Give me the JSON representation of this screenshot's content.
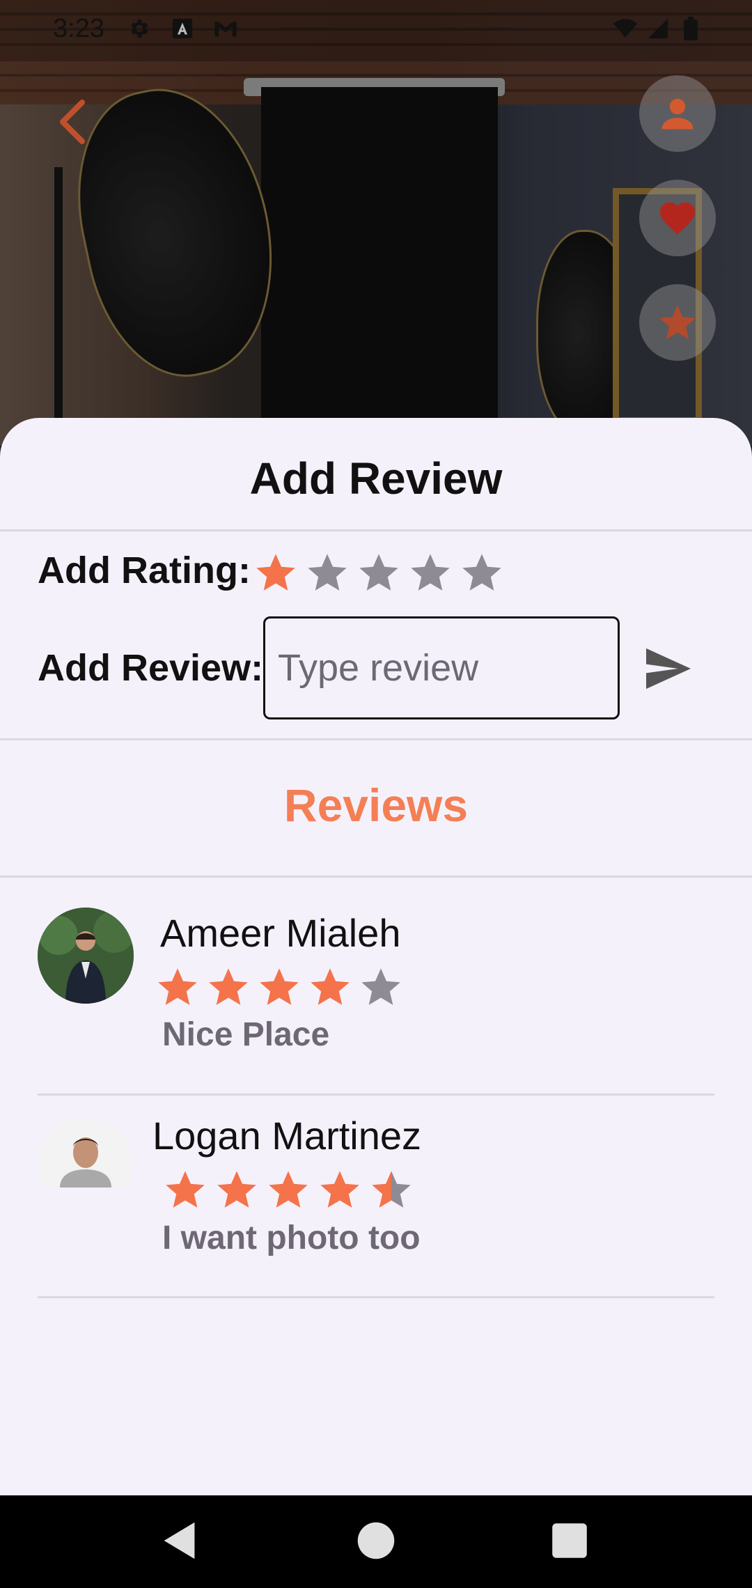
{
  "status_bar": {
    "time": "3:23",
    "left_icons": [
      "settings-icon",
      "a-icon",
      "gmail-icon"
    ],
    "right_icons": [
      "wifi-icon",
      "signal-icon",
      "battery-icon"
    ]
  },
  "hero": {
    "description_icons": [
      "back-icon",
      "profile-icon",
      "heart-icon",
      "star-icon"
    ]
  },
  "sheet": {
    "title": "Add Review",
    "rating_label": "Add Rating:",
    "rating_value": 1,
    "rating_max": 5,
    "review_label": "Add Review:",
    "review_placeholder": "Type review",
    "review_value": "",
    "reviews_heading": "Reviews"
  },
  "reviews": [
    {
      "name": "Ameer Mialeh",
      "rating": 4,
      "text": "Nice Place"
    },
    {
      "name": "Logan Martinez",
      "rating": 4.5,
      "text": "I want photo too"
    }
  ],
  "colors": {
    "accent": "#f47f55",
    "star_on": "#f4734a",
    "star_off": "#8e8b94",
    "sheet_bg": "#f5f1fb",
    "heart": "#b3261e"
  }
}
